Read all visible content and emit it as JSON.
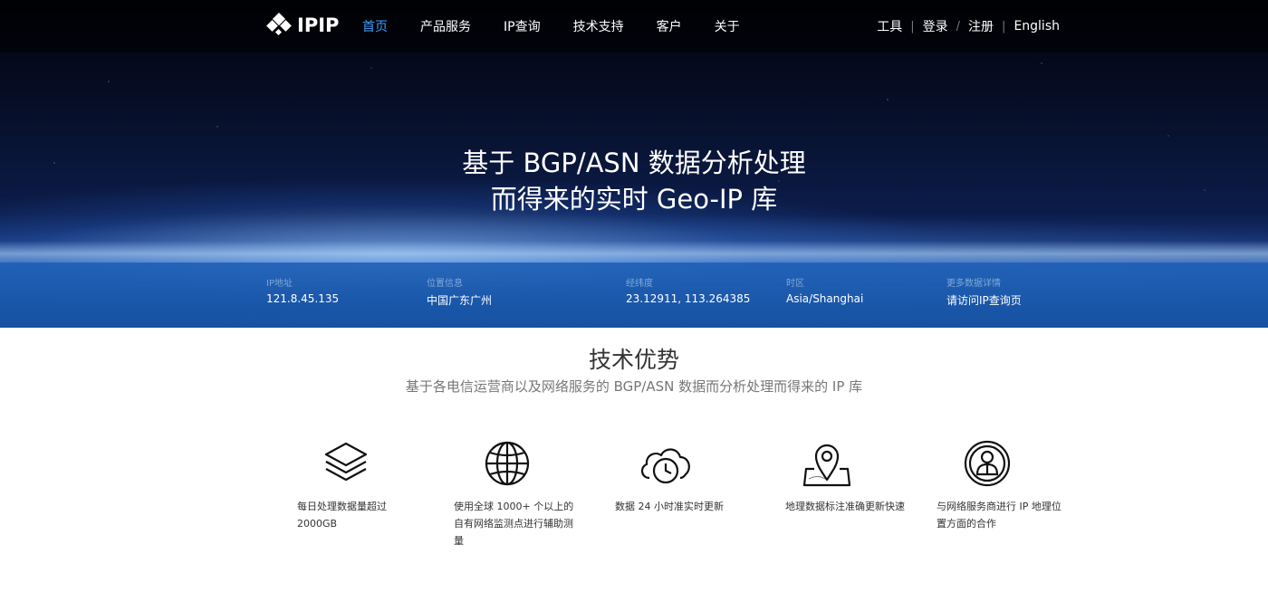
{
  "nav": {
    "logo_text": "IPIP",
    "menu": [
      {
        "label": "首页",
        "active": true
      },
      {
        "label": "产品服务",
        "active": false
      },
      {
        "label": "IP查询",
        "active": false
      },
      {
        "label": "技术支持",
        "active": false
      },
      {
        "label": "客户",
        "active": false
      },
      {
        "label": "关于",
        "active": false
      }
    ],
    "right": {
      "tools": "工具",
      "login": "登录",
      "register": "注册",
      "language": "English",
      "slash": "/",
      "pipe": "|"
    }
  },
  "hero": {
    "line1": "基于 BGP/ASN 数据分析处理",
    "line2": "而得来的实时 Geo-IP 库"
  },
  "info": [
    {
      "label": "IP地址",
      "value": "121.8.45.135"
    },
    {
      "label": "位置信息",
      "value": "中国广东广州"
    },
    {
      "label": "经纬度",
      "value": "23.12911, 113.264385"
    },
    {
      "label": "时区",
      "value": "Asia/Shanghai"
    },
    {
      "label": "更多数据详情",
      "value": "请访问IP查询页"
    }
  ],
  "features_section": {
    "title": "技术优势",
    "subtitle": "基于各电信运营商以及网络服务的 BGP/ASN 数据而分析处理而得来的 IP 库"
  },
  "features": [
    {
      "icon": "layers-icon",
      "text": "每日处理数据量超过 2000GB"
    },
    {
      "icon": "globe-icon",
      "text": "使用全球 1000+ 个以上的自有网络监测点进行辅助测量"
    },
    {
      "icon": "cloud-clock-icon",
      "text": "数据 24 小时准实时更新"
    },
    {
      "icon": "map-pin-icon",
      "text": "地理数据标注准确更新快速"
    },
    {
      "icon": "user-circle-icon",
      "text": "与网络服务商进行 IP 地理位置方面的合作"
    }
  ],
  "colors": {
    "nav_active": "#3aa0ff",
    "info_band": "#1e5fb5"
  }
}
